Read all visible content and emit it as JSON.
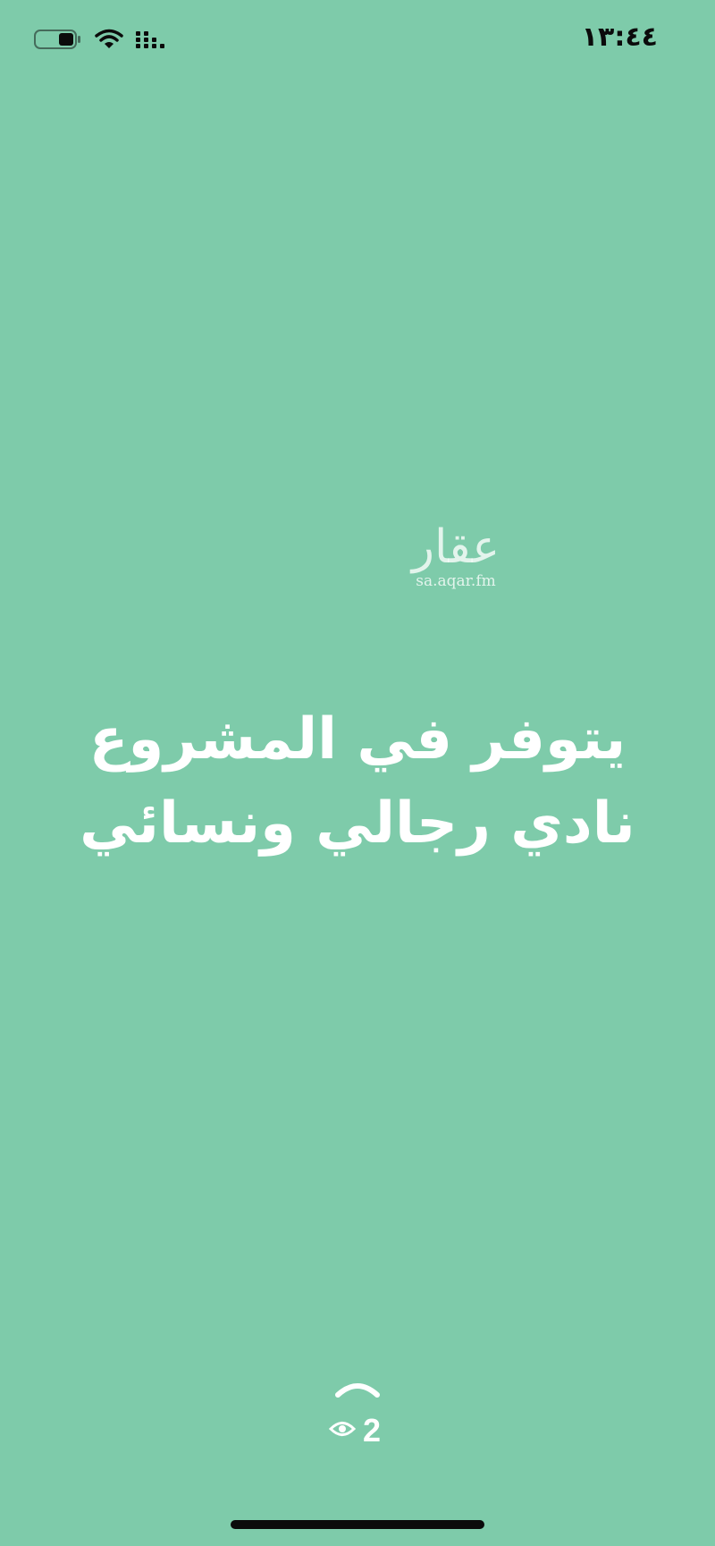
{
  "status_bar": {
    "time": "١٣:٤٤",
    "icons": [
      "battery-icon",
      "wifi-icon",
      "signal-icon"
    ]
  },
  "watermark": {
    "logo_text": "عقار",
    "url": "sa.aqar.fm"
  },
  "story": {
    "line1": "يتوفر في المشروع",
    "line2": "نادي رجالي ونسائي",
    "background_color": "#7ecbaa"
  },
  "footer": {
    "swipe_icon": "chevron-up-icon",
    "views_icon": "eye-icon",
    "views_count": "2"
  }
}
